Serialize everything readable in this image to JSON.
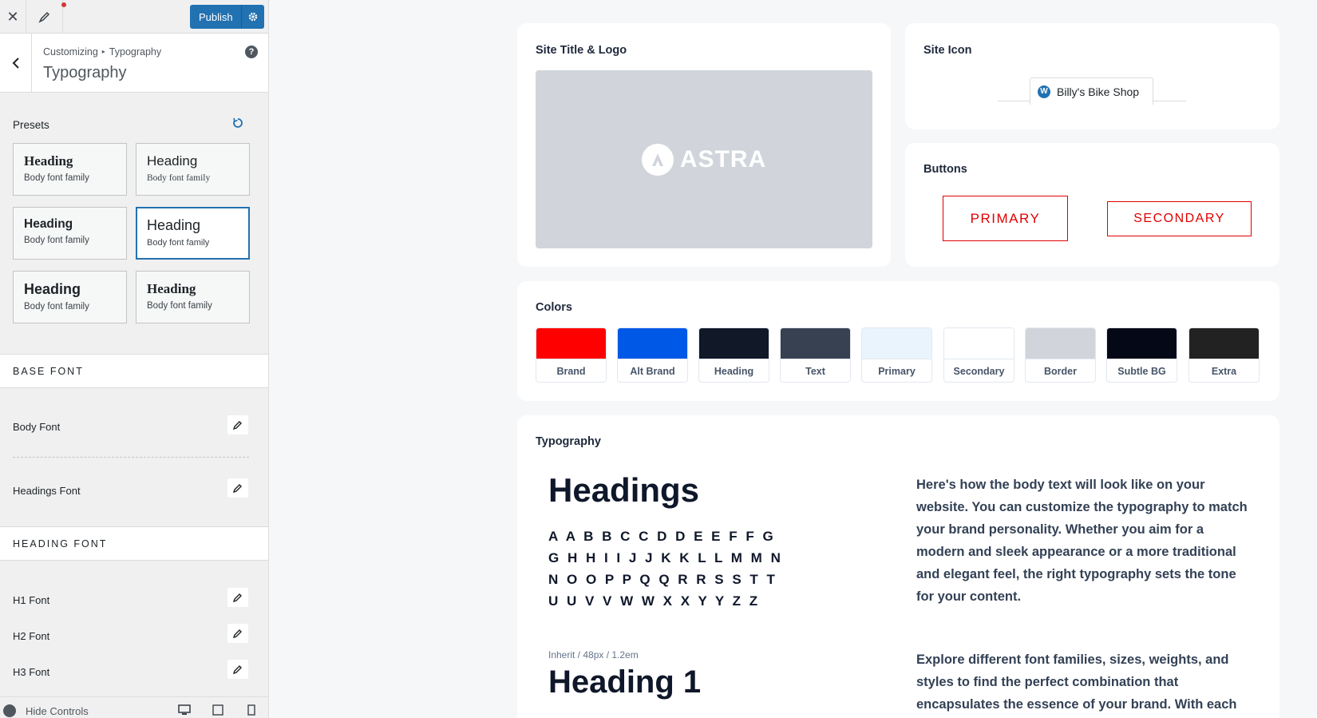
{
  "topbar": {
    "publish_label": "Publish"
  },
  "panel": {
    "breadcrumb_root": "Customizing",
    "breadcrumb_sep": "▸",
    "breadcrumb_leaf": "Typography",
    "title": "Typography",
    "help": "?"
  },
  "presets": {
    "label": "Presets",
    "items": [
      {
        "heading": "Heading",
        "body": "Body font family"
      },
      {
        "heading": "Heading",
        "body": "Body font family"
      },
      {
        "heading": "Heading",
        "body": "Body font family"
      },
      {
        "heading": "Heading",
        "body": "Body font family"
      },
      {
        "heading": "Heading",
        "body": "Body font family"
      },
      {
        "heading": "Heading",
        "body": "Body font family"
      }
    ]
  },
  "base_font": {
    "section": "BASE FONT",
    "body_font": "Body Font",
    "headings_font": "Headings Font"
  },
  "heading_font": {
    "section": "HEADING FONT",
    "h1": "H1 Font",
    "h2": "H2 Font",
    "h3": "H3 Font"
  },
  "footer": {
    "hide_controls": "Hide Controls"
  },
  "preview": {
    "site_title_logo": "Site Title & Logo",
    "logo_text": "ASTRA",
    "site_icon": "Site Icon",
    "site_name": "Billy's Bike Shop",
    "buttons": "Buttons",
    "primary": "PRIMARY",
    "secondary": "SECONDARY",
    "colors": "Colors",
    "swatches": [
      {
        "name": "Brand",
        "color": "#ff0000"
      },
      {
        "name": "Alt Brand",
        "color": "#0058e6"
      },
      {
        "name": "Heading",
        "color": "#111827"
      },
      {
        "name": "Text",
        "color": "#374151"
      },
      {
        "name": "Primary",
        "color": "#eaf4fd"
      },
      {
        "name": "Secondary",
        "color": "#ffffff"
      },
      {
        "name": "Border",
        "color": "#d1d5db"
      },
      {
        "name": "Subtle BG",
        "color": "#050816"
      },
      {
        "name": "Extra",
        "color": "#222222"
      }
    ],
    "typography": "Typography",
    "headings": "Headings",
    "alphabet": "A A B B C C D D E E F F G G H H I I J J K K L L M M N N O O P P Q Q R R S S T T U U V V W W X X Y Y Z Z",
    "h1_spec": "Inherit / 48px / 1.2em",
    "h1_sample": "Heading 1",
    "body_para_1": "Here's how the body text will look like on your website. You can customize the typography to match your brand personality. Whether you aim for a modern and sleek appearance or a more traditional and elegant feel, the right typography sets the tone for your content.",
    "body_para_2": "Explore different font families, sizes, weights, and styles to find the perfect combination that encapsulates the essence of your brand. With each"
  }
}
